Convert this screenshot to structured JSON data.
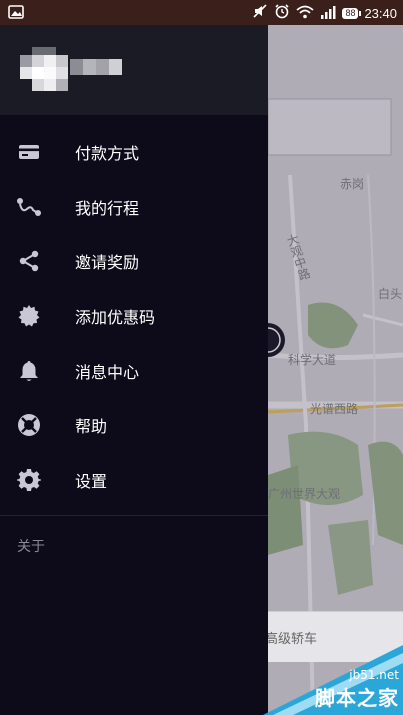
{
  "status_bar": {
    "time": "23:40",
    "battery": "88",
    "icons": [
      "image-icon",
      "mute-icon",
      "alarm-icon",
      "wifi-icon",
      "signal-icon",
      "battery-icon"
    ]
  },
  "drawer": {
    "menu": [
      {
        "label": "付款方式",
        "icon": "card-icon"
      },
      {
        "label": "我的行程",
        "icon": "route-icon"
      },
      {
        "label": "邀请奖励",
        "icon": "share-icon"
      },
      {
        "label": "添加优惠码",
        "icon": "badge-icon"
      },
      {
        "label": "消息中心",
        "icon": "bell-icon"
      },
      {
        "label": "帮助",
        "icon": "lifebuoy-icon"
      },
      {
        "label": "设置",
        "icon": "gear-icon"
      }
    ],
    "about": "关于"
  },
  "map": {
    "labels": [
      "赤岗",
      "大观中路",
      "白头",
      "科学大道",
      "光谱西路",
      "广州世界大观"
    ],
    "bottom_label": "高级轿车"
  },
  "watermark": {
    "site": "jb51.net",
    "name": "脚本之家"
  },
  "colors": {
    "drawer_bg": "#0d0b1a",
    "header_bg": "#1b1b25",
    "status_bg": "#3a1f1a",
    "text": "#ffffff"
  }
}
